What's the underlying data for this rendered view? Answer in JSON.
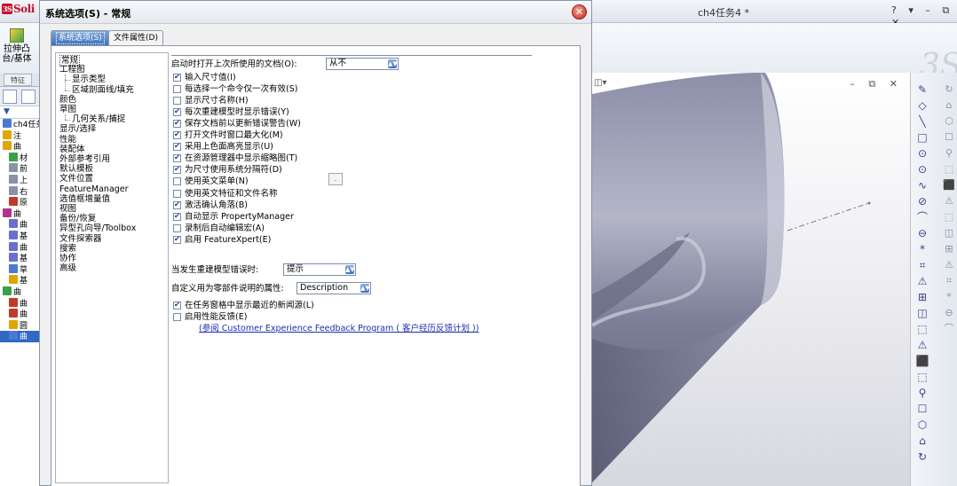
{
  "app": {
    "logo": "Soli",
    "doc_title": "ch4任务4 *",
    "help_controls": "? ▾ – ⧉ ✕"
  },
  "ribbon": {
    "extrude_label_1": "拉伸凸",
    "extrude_label_2": "台/基体",
    "tab_feature": "特征"
  },
  "feature_tree": {
    "rows": [
      {
        "label": "ch4任务",
        "icon_color": "#4a7bd0"
      },
      {
        "label": "注",
        "icon_color": "#e0a600"
      },
      {
        "label": "曲",
        "icon_color": "#e0a600"
      },
      {
        "label": "材",
        "icon_color": "#3aa14a"
      },
      {
        "label": "前",
        "icon_color": "#8893a8"
      },
      {
        "label": "上",
        "icon_color": "#8893a8"
      },
      {
        "label": "右",
        "icon_color": "#8893a8"
      },
      {
        "label": "原",
        "icon_color": "#c03a2b"
      },
      {
        "label": "曲",
        "icon_color": "#b2338f"
      },
      {
        "label": "曲",
        "icon_color": "#6a6fd0"
      },
      {
        "label": "基",
        "icon_color": "#6a6fd0"
      },
      {
        "label": "曲",
        "icon_color": "#6a6fd0"
      },
      {
        "label": "基",
        "icon_color": "#6a6fd0"
      },
      {
        "label": "草",
        "icon_color": "#4a7bd0"
      },
      {
        "label": "基",
        "icon_color": "#e0a600"
      },
      {
        "label": "曲",
        "icon_color": "#3aa14a"
      },
      {
        "label": "曲",
        "icon_color": "#c03a2b"
      },
      {
        "label": "曲",
        "icon_color": "#c03a2b"
      },
      {
        "label": "圆",
        "icon_color": "#e0a600"
      },
      {
        "label": "曲",
        "icon_color": "#4a7bd0"
      }
    ]
  },
  "dialog": {
    "title": "系统选项(S) - 常规",
    "close_glyph": "✕",
    "tabs": {
      "system": "系统选项(S)",
      "document": "文件属性(D)"
    },
    "categories": [
      "常规",
      "工程图",
      "显示类型",
      "区域剖面线/填充",
      "颜色",
      "草图",
      "几何关系/捕捉",
      "显示/选择",
      "性能",
      "装配体",
      "外部参考引用",
      "默认模板",
      "文件位置",
      "FeatureManager",
      "选值框增量值",
      "视图",
      "备份/恢复",
      "异型孔向导/Toolbox",
      "文件探索器",
      "搜索",
      "协作",
      "高级"
    ],
    "general": {
      "reopen_label": "启动时打开上次所使用的文档(O):",
      "reopen_value": "从不",
      "checkboxes": [
        {
          "label": "输入尺寸值(I)",
          "checked": true
        },
        {
          "label": "每选择一个命令仅一次有效(S)",
          "checked": false
        },
        {
          "label": "显示尺寸名称(H)",
          "checked": false
        },
        {
          "label": "每次重建模型时显示错误(Y)",
          "checked": true
        },
        {
          "label": "保存文档前以更新错误警告(W)",
          "checked": true
        },
        {
          "label": "打开文件时窗口最大化(M)",
          "checked": true
        },
        {
          "label": "采用上色面高亮显示(U)",
          "checked": true
        },
        {
          "label": "在资源管理器中显示缩略图(T)",
          "checked": true
        },
        {
          "label": "为尺寸使用系统分隔符(D)",
          "checked": true
        },
        {
          "label": "使用英文菜单(N)",
          "checked": false
        },
        {
          "label": "使用英文特征和文件名称",
          "checked": false
        },
        {
          "label": "激活确认角落(B)",
          "checked": true
        },
        {
          "label": "自动显示 PropertyManager",
          "checked": true
        },
        {
          "label": "录制后自动编辑宏(A)",
          "checked": false
        },
        {
          "label": "启用 FeatureXpert(E)",
          "checked": true
        }
      ],
      "separator_value": ".",
      "rebuild_label": "当发生重建模型错误时:",
      "rebuild_value": "提示",
      "custom_prop_label": "自定义用为零部件说明的属性:",
      "custom_prop_value": "Description",
      "checkboxes2": [
        {
          "label": "在任务窗格中显示最近的新闻源(L)",
          "checked": true
        },
        {
          "label": "启用性能反馈(E)",
          "checked": false
        }
      ],
      "feedback_link": "(参阅 Customer Experience Feedback Program ( 客户经历反馈计划 ))"
    }
  },
  "viewport": {
    "menu": "▾",
    "controls": "– ⧉ ✕"
  },
  "right_toolbar": {
    "icons": [
      "✎",
      "◇",
      "╲",
      "□",
      "⊙",
      "⊙",
      "∿",
      "⊘",
      "⌒",
      "⊖",
      "*",
      "⌗",
      "⚠",
      "⊞",
      "◫",
      "⬚",
      "⚠",
      "⬛",
      "⬚",
      "⚲",
      "☐",
      "⬡",
      "⌂",
      "↻"
    ]
  }
}
